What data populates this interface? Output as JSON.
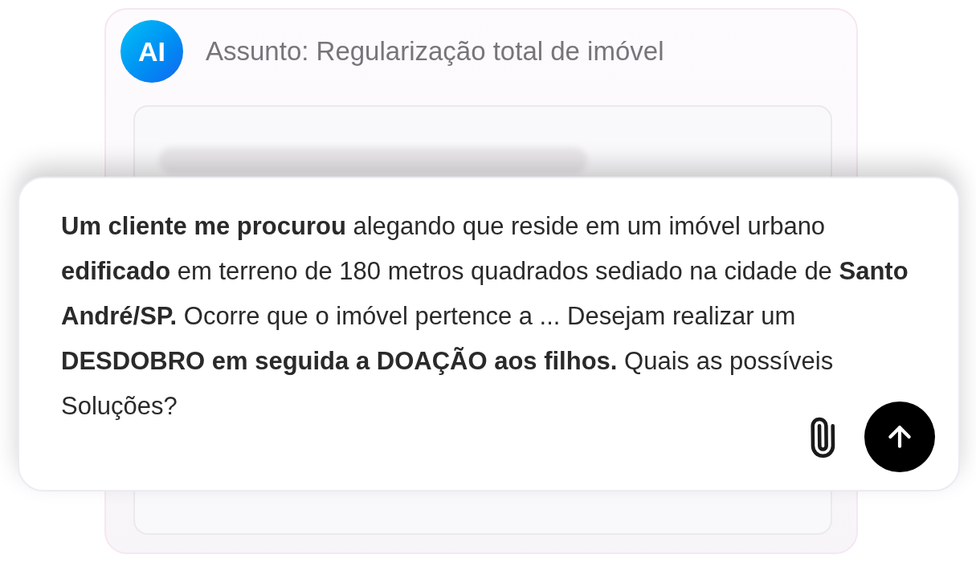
{
  "header": {
    "avatar": "AI",
    "subject": "Assunto: Regularização total de imóvel"
  },
  "prompt": {
    "text": "**Um cliente me procurou** alegando que reside em um imóvel urbano **edificado** em terreno de 180 metros quadrados sediado na cidade de **Santo André/SP.** Ocorre que o imóvel pertence a ... Desejam realizar um **DESDOBRO em seguida a DOAÇÃO aos filhos.** Quais as possíveis Soluções?"
  }
}
